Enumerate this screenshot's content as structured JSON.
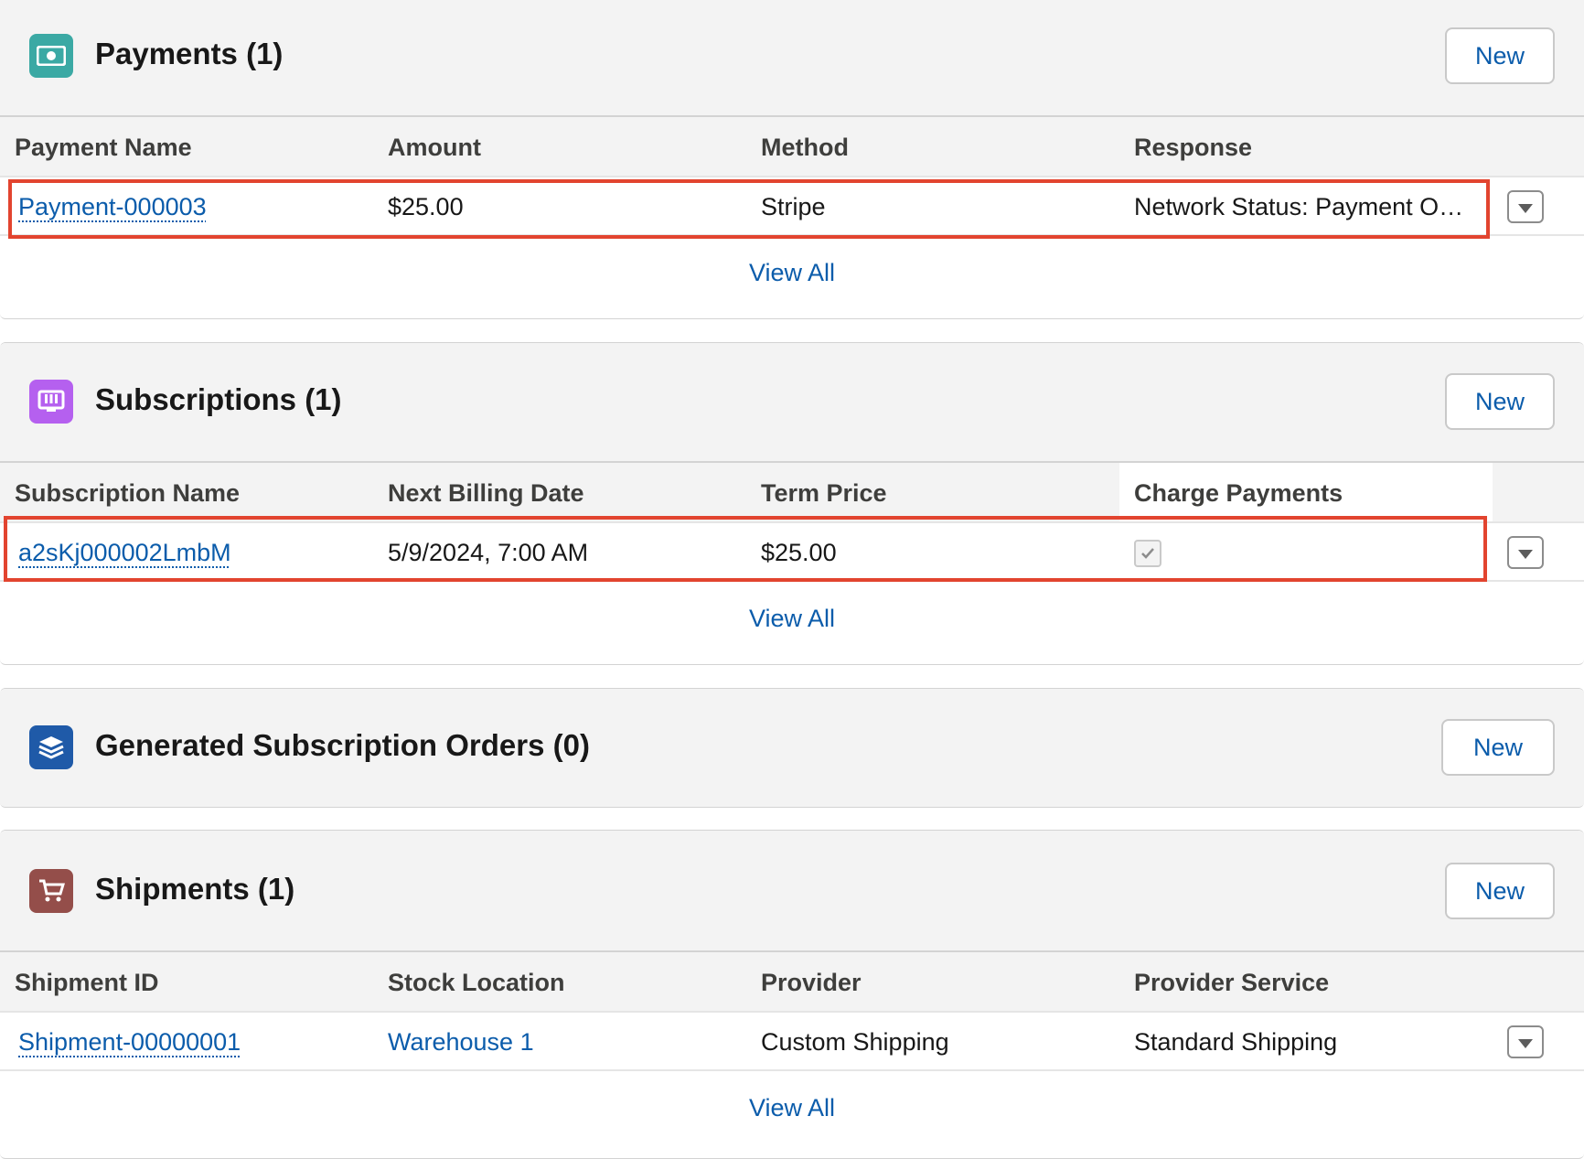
{
  "payments": {
    "title": "Payments (1)",
    "new_label": "New",
    "icon": "money-icon",
    "icon_color": "#3ba9a4",
    "columns": [
      "Payment Name",
      "Amount",
      "Method",
      "Response"
    ],
    "rows": [
      {
        "name": "Payment-000003",
        "amount": "$25.00",
        "method": "Stripe",
        "response": "Network Status: Payment Outcome Authorized"
      }
    ],
    "view_all": "View All"
  },
  "subscriptions": {
    "title": "Subscriptions (1)",
    "new_label": "New",
    "icon": "book-icon",
    "icon_color": "#b560ef",
    "columns": [
      "Subscription Name",
      "Next Billing Date",
      "Term Price",
      "Charge Payments"
    ],
    "rows": [
      {
        "name": "a2sKj000002LmbM",
        "next_billing": "5/9/2024, 7:00 AM",
        "term_price": "$25.00",
        "charge_payments": true
      }
    ],
    "view_all": "View All"
  },
  "generated_orders": {
    "title": "Generated Subscription Orders (0)",
    "new_label": "New",
    "icon": "stack-icon",
    "icon_color": "#1f5aa8"
  },
  "shipments": {
    "title": "Shipments (1)",
    "new_label": "New",
    "icon": "cart-icon",
    "icon_color": "#944e4a",
    "columns": [
      "Shipment ID",
      "Stock Location",
      "Provider",
      "Provider Service"
    ],
    "rows": [
      {
        "id": "Shipment-00000001",
        "stock_location": "Warehouse 1",
        "provider": "Custom Shipping",
        "service": "Standard Shipping"
      }
    ],
    "view_all": "View All"
  },
  "highlight_color": "#e2442f"
}
